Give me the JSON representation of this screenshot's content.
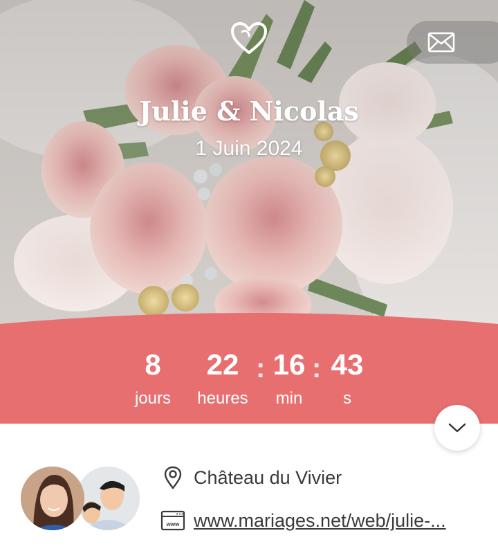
{
  "hero": {
    "title": "Julie & Nicolas",
    "date": "1 Juin 2024",
    "icons": {
      "logo": "heart-icon",
      "contact": "mail-icon"
    }
  },
  "countdown": {
    "accent_color": "#e86f70",
    "items": [
      {
        "value": "8",
        "label": "jours"
      },
      {
        "value": "22",
        "label": "heures"
      },
      {
        "value": "16",
        "label": "min"
      },
      {
        "value": "43",
        "label": "s"
      }
    ],
    "separator": ":"
  },
  "details": {
    "location": "Château du Vivier",
    "website": "www.mariages.net/web/julie-...",
    "icons": {
      "location": "map-pin-icon",
      "website": "web-icon",
      "scroll": "chevron-down-icon"
    }
  }
}
